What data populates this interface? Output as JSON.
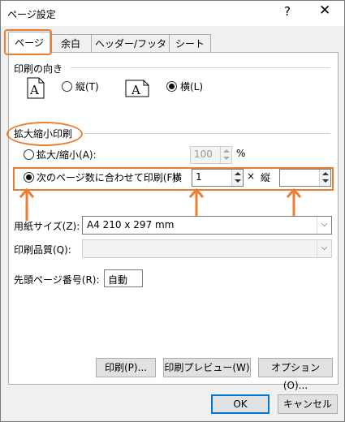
{
  "window": {
    "title": "ページ設定",
    "help": "?",
    "close": "✕"
  },
  "tabs": [
    {
      "label": "ページ"
    },
    {
      "label": "余白"
    },
    {
      "label": "ヘッダー/フッター"
    },
    {
      "label": "シート"
    }
  ],
  "orientation": {
    "section": "印刷の向き",
    "portrait_label": "縦(T)",
    "landscape_label": "横(L)",
    "selected": "landscape"
  },
  "scaling": {
    "section": "拡大縮小印刷",
    "zoom_label": "拡大/縮小(A):",
    "zoom_value": "100",
    "zoom_unit": "%",
    "fit_label": "次のページ数に合わせて印刷(F):",
    "wide_label": "横",
    "wide_value": "1",
    "times": "×",
    "tall_label": "縦",
    "tall_value": ""
  },
  "paper": {
    "size_label": "用紙サイズ(Z):",
    "size_value": "A4 210 x 297 mm",
    "quality_label": "印刷品質(Q):",
    "quality_value": "",
    "first_page_label": "先頭ページ番号(R):",
    "first_page_value": "自動"
  },
  "buttons": {
    "print": "印刷(P)...",
    "preview": "印刷プレビュー(W)",
    "options": "オプション(O)...",
    "ok": "OK",
    "cancel": "キャンセル"
  },
  "colors": {
    "highlight": "#ed7d31",
    "accent": "#0078d7"
  }
}
